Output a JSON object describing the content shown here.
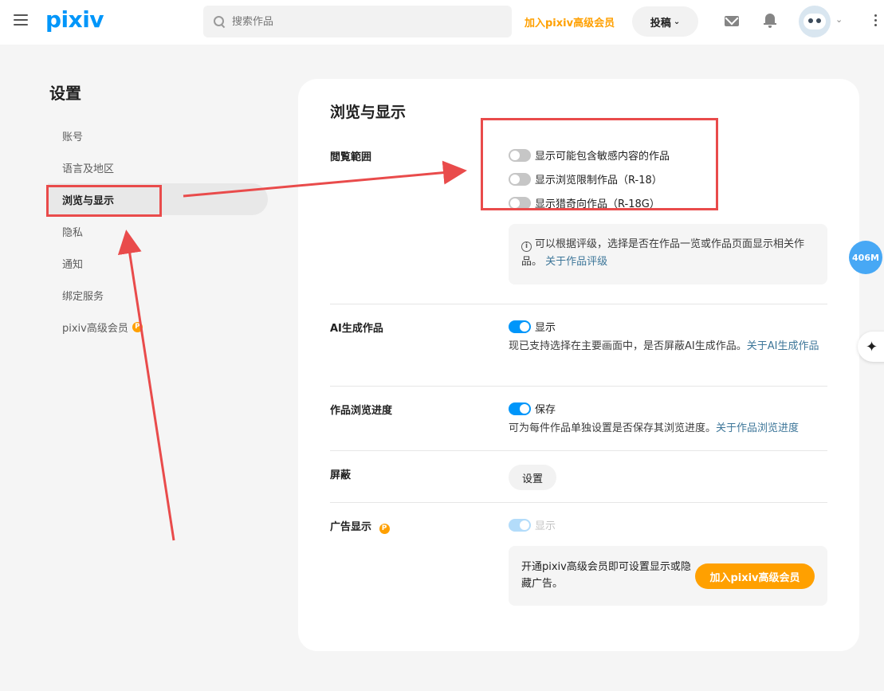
{
  "topbar": {
    "logo": "pixiv",
    "search_placeholder": "搜索作品",
    "premium_link": "加入pixiv高级会员",
    "post_button": "投稿",
    "icons": [
      "menu-icon",
      "search-icon",
      "mail-icon",
      "bell-icon",
      "chevron-down-icon",
      "more-icon"
    ]
  },
  "sidebar": {
    "title": "设置",
    "items": [
      {
        "label": "账号",
        "active": false
      },
      {
        "label": "语言及地区",
        "active": false
      },
      {
        "label": "浏览与显示",
        "active": true
      },
      {
        "label": "隐私",
        "active": false
      },
      {
        "label": "通知",
        "active": false
      },
      {
        "label": "绑定服务",
        "active": false
      },
      {
        "label": "pixiv高级会员",
        "active": false,
        "badge": "P"
      }
    ]
  },
  "main": {
    "title": "浏览与显示",
    "viewing_range": {
      "label": "閲覧範囲",
      "options": [
        {
          "label": "显示可能包含敏感内容的作品",
          "on": false
        },
        {
          "label": "显示浏览限制作品（R-18）",
          "on": false
        },
        {
          "label": "显示猎奇向作品（R-18G）",
          "on": false
        }
      ],
      "info_text": "可以根据评级，选择是否在作品一览或作品页面显示相关作品。",
      "info_link": "关于作品评级"
    },
    "ai": {
      "label": "AI生成作品",
      "toggle_label": "显示",
      "on": true,
      "desc": "现已支持选择在主要画面中，是否屏蔽AI生成作品。",
      "link": "关于AI生成作品"
    },
    "progress": {
      "label": "作品浏览进度",
      "toggle_label": "保存",
      "on": true,
      "desc": "可为每件作品单独设置是否保存其浏览进度。",
      "link": "关于作品浏览进度"
    },
    "mute": {
      "label": "屏蔽",
      "button": "设置"
    },
    "ads": {
      "label": "广告显示",
      "badge": "P",
      "toggle_label": "显示",
      "disabled": true,
      "promo_text": "开通pixiv高级会员即可设置显示或隐藏广告。",
      "promo_button": "加入pixiv高级会员"
    }
  },
  "floating": {
    "badge": "406M",
    "ai_icon": "sparkle-icon"
  },
  "colors": {
    "accent": "#0096fa",
    "premium": "#ffa000",
    "annotation": "#e94b4b",
    "link": "#3d7699"
  }
}
